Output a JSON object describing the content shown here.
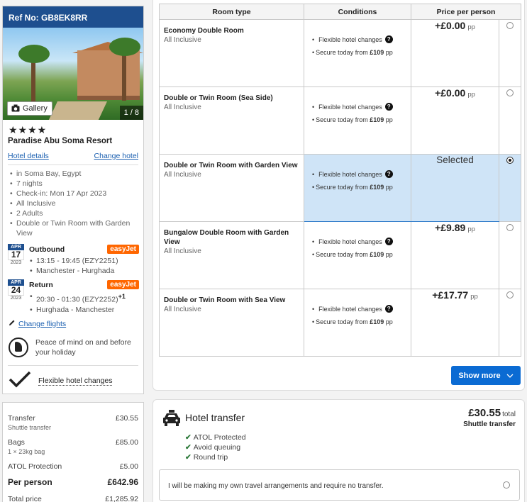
{
  "hotel": {
    "ref": "Ref No: GB8EK8RR",
    "gallery_label": "Gallery",
    "image_count": "1 / 8",
    "stars": "★★★★",
    "name": "Paradise Abu Soma Resort",
    "details_link": "Hotel details",
    "change_link": "Change hotel",
    "details": [
      "in Soma Bay, Egypt",
      "7 nights",
      "Check-in: Mon 17 Apr 2023",
      "All Inclusive",
      "2 Adults",
      "Double or Twin Room with Garden View"
    ]
  },
  "flights": {
    "outbound": {
      "month": "APR",
      "day": "17",
      "year": "2023",
      "label": "Outbound",
      "airline": "easyJet",
      "time": "13:15 - 19:45 (EZY2251)",
      "route": "Manchester - Hurghada"
    },
    "return": {
      "month": "APR",
      "day": "24",
      "year": "2023",
      "label": "Return",
      "airline": "easyJet",
      "time": "20:30 - 01:30 (EZY2252)",
      "day_offset": "+1",
      "route": "Hurghada - Manchester"
    },
    "change_link": "Change flights"
  },
  "atol_text": "Peace of mind on and before your holiday",
  "flex_label": "Flexible hotel changes",
  "pricing": {
    "transfer_label": "Transfer",
    "transfer_sub": "Shuttle transfer",
    "transfer_value": "£30.55",
    "bags_label": "Bags",
    "bags_sub": "1 × 23kg bag",
    "bags_value": "£85.00",
    "atol_label": "ATOL Protection",
    "atol_value": "£5.00",
    "per_person_label": "Per person",
    "per_person_value": "£642.96",
    "total_label": "Total price",
    "total_value": "£1,285.92"
  },
  "table": {
    "headers": [
      "Room type",
      "Conditions",
      "Price per person"
    ],
    "cond_flex": "Flexible hotel changes",
    "cond_secure_prefix": "Secure today from",
    "cond_secure_amount": "£109",
    "cond_secure_suffix": "pp",
    "pp": "pp",
    "selected_label": "Selected",
    "rooms": [
      {
        "name": "Economy Double Room",
        "board": "All Inclusive",
        "price": "+£0.00"
      },
      {
        "name": "Double or Twin Room (Sea Side)",
        "board": "All Inclusive",
        "price": "+£0.00"
      },
      {
        "name": "Double or Twin Room with Garden View",
        "board": "All Inclusive",
        "price": ""
      },
      {
        "name": "Bungalow Double Room with Garden View",
        "board": "All Inclusive",
        "price": "+£9.89"
      },
      {
        "name": "Double or Twin Room with Sea View",
        "board": "All Inclusive",
        "price": "+£17.77"
      }
    ],
    "show_more": "Show more"
  },
  "transfer": {
    "title": "Hotel transfer",
    "price": "£30.55",
    "total_word": "total",
    "type": "Shuttle transfer",
    "features": [
      "ATOL Protected",
      "Avoid queuing",
      "Round trip"
    ],
    "own_option": "I will be making my own travel arrangements and require no transfer."
  }
}
